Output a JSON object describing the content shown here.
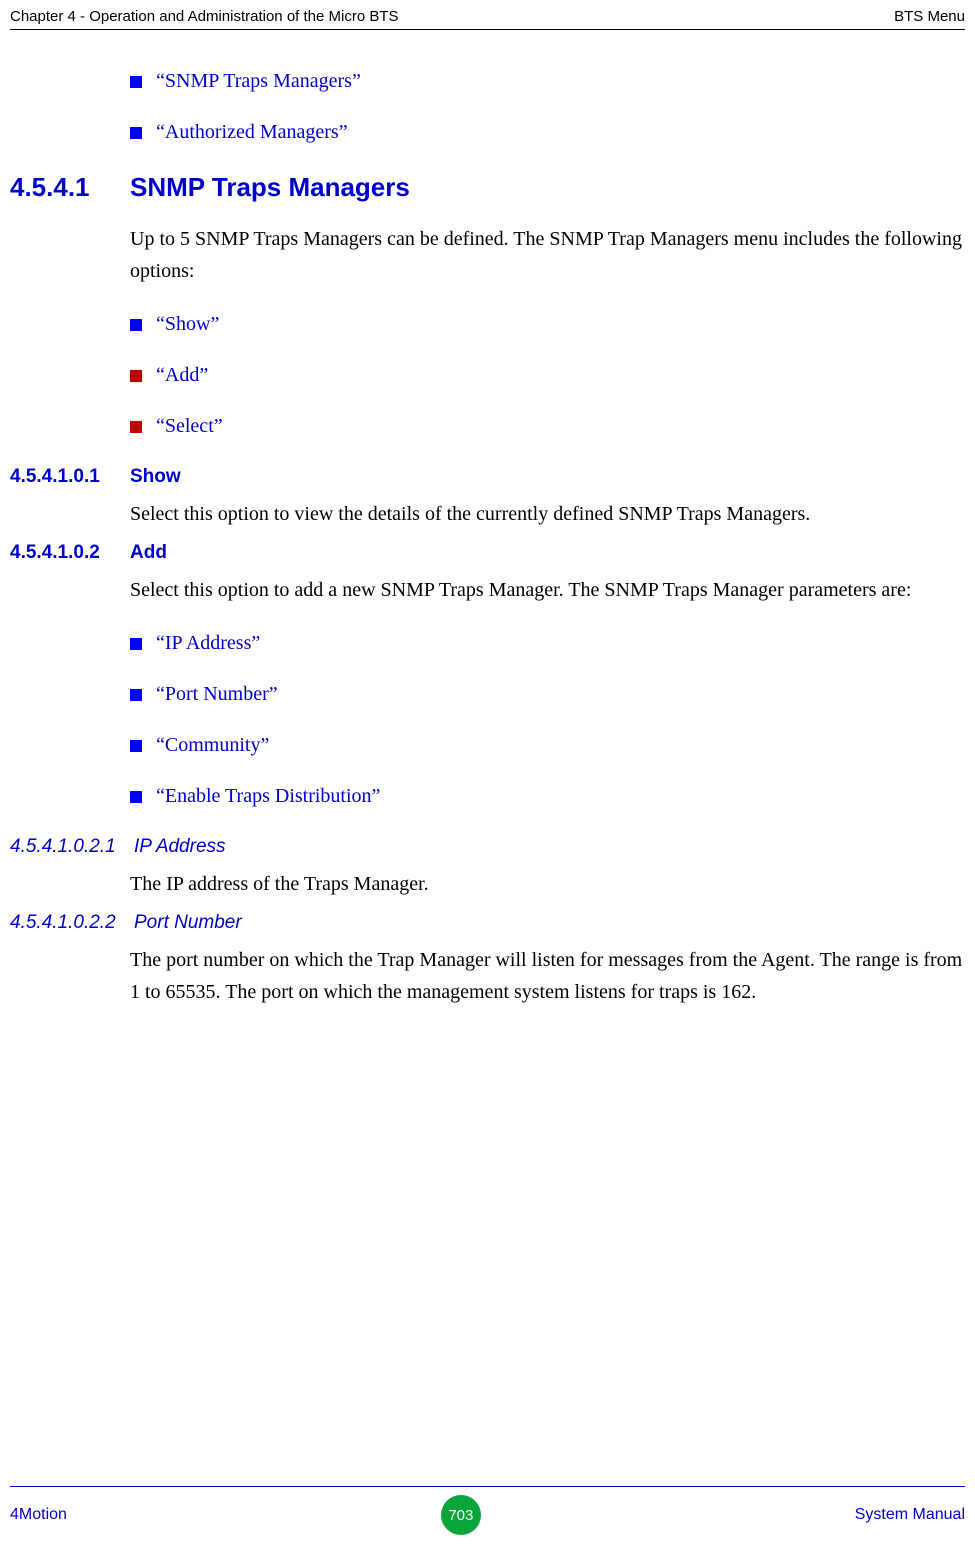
{
  "header": {
    "left": "Chapter 4 - Operation and Administration of the Micro BTS",
    "right": "BTS Menu"
  },
  "bullets_top": [
    {
      "square_color": "#0000ff",
      "text": "“SNMP Traps Managers”"
    },
    {
      "square_color": "#0000ff",
      "text": "“Authorized Managers”"
    }
  ],
  "section_1": {
    "number": "4.5.4.1",
    "title": "SNMP Traps Managers",
    "body": "Up to 5 SNMP Traps Managers can be defined. The SNMP Trap Managers menu includes the following options:",
    "bullets": [
      {
        "square_color": "#0000ff",
        "text": "“Show”"
      },
      {
        "square_color": "#c00000",
        "text": "“Add”"
      },
      {
        "square_color": "#c00000",
        "text": "“Select”"
      }
    ]
  },
  "section_show": {
    "number": "4.5.4.1.0.1",
    "title": "Show",
    "body": "Select this option to view the details of the currently defined SNMP Traps Managers."
  },
  "section_add": {
    "number": "4.5.4.1.0.2",
    "title": "Add",
    "body": "Select this option to add a new SNMP Traps Manager. The SNMP Traps Manager parameters are:",
    "bullets": [
      {
        "square_color": "#0000ff",
        "text": "“IP Address”"
      },
      {
        "square_color": "#0000ff",
        "text": "“Port Number”"
      },
      {
        "square_color": "#0000ff",
        "text": "“Community”"
      },
      {
        "square_color": "#0000ff",
        "text": "“Enable Traps Distribution”"
      }
    ]
  },
  "section_ip": {
    "number": "4.5.4.1.0.2.1",
    "title": "IP Address",
    "body": "The IP address of the Traps Manager."
  },
  "section_port": {
    "number": "4.5.4.1.0.2.2",
    "title": "Port Number",
    "body": "The port number on which the Trap Manager will listen for messages from the Agent. The range is from 1 to 65535. The port on which the management system listens for traps is 162."
  },
  "footer": {
    "left": "4Motion",
    "page": "703",
    "right": "System Manual"
  }
}
